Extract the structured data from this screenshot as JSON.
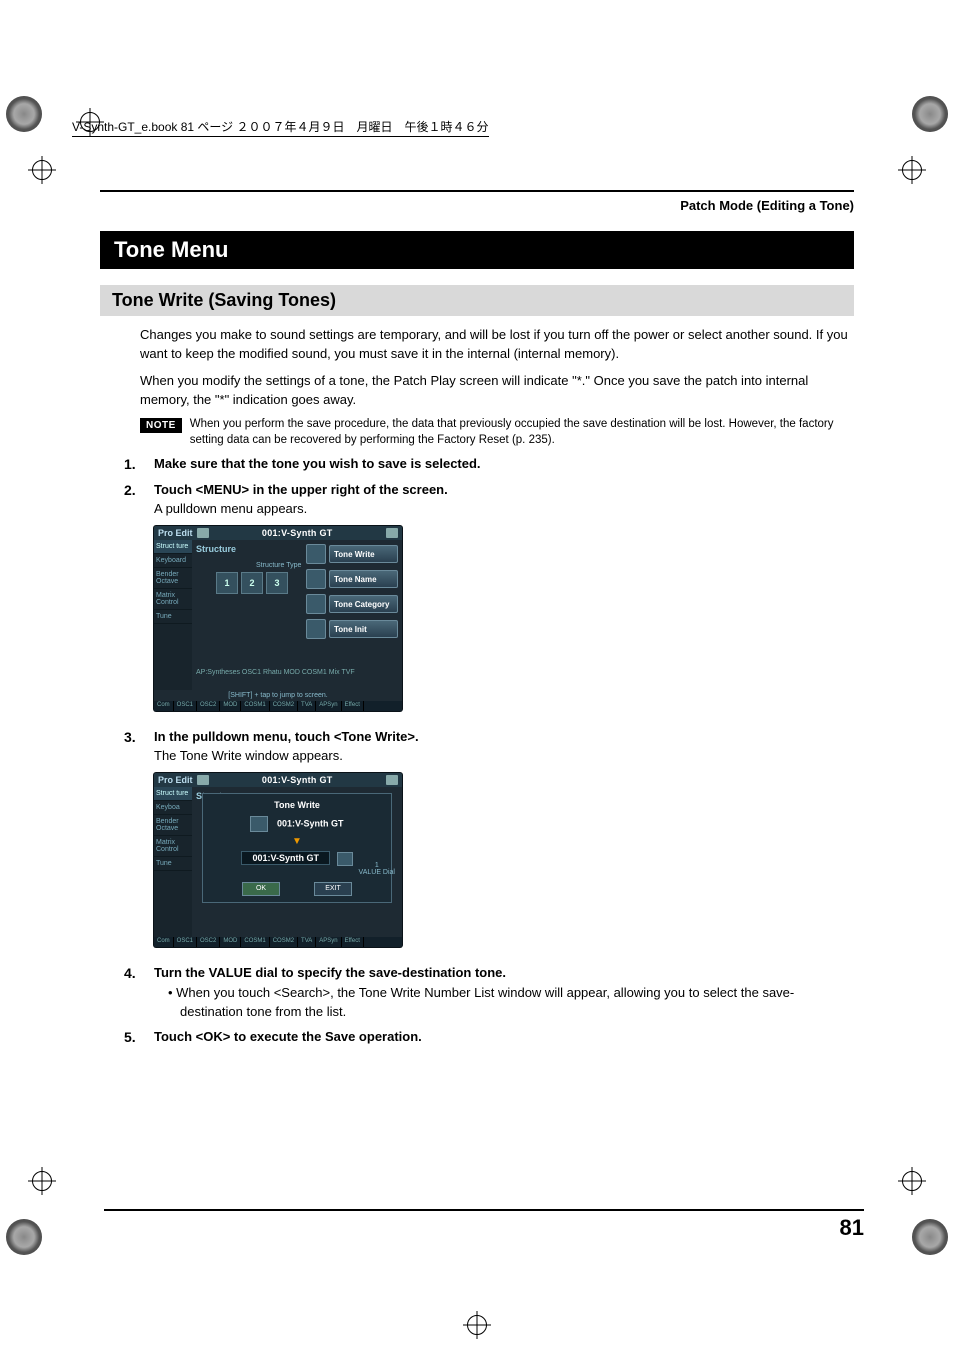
{
  "header_line": "V-Synth-GT_e.book  81 ページ  ２００７年４月９日　月曜日　午後１時４６分",
  "page_heading": "Patch Mode (Editing a Tone)",
  "section_title": "Tone Menu",
  "subsection_title": "Tone Write (Saving Tones)",
  "intro_p1": "Changes you make to sound settings are temporary, and will be lost if you turn off the power or select another sound. If you want to keep the modified sound, you must save it in the internal (internal memory).",
  "intro_p2": "When you modify the settings of a tone, the Patch Play screen will indicate \"*.\" Once you save the patch into internal memory, the \"*\" indication goes away.",
  "note_badge": "NOTE",
  "note_text": "When you perform the save procedure, the data that previously occupied the save destination will be lost. However, the factory setting data can be recovered by performing the Factory Reset (p. 235).",
  "steps": {
    "s1": {
      "num": "1.",
      "title": "Make sure that the tone you wish to save is selected."
    },
    "s2": {
      "num": "2.",
      "title": "Touch <MENU> in the upper right of the screen.",
      "desc": "A pulldown menu appears."
    },
    "s3": {
      "num": "3.",
      "title": "In the pulldown menu, touch <Tone Write>.",
      "desc": "The Tone Write window appears."
    },
    "s4": {
      "num": "4.",
      "title": "Turn the VALUE dial to specify the save-destination tone.",
      "bullet": "• When you touch <Search>, the Tone Write Number List window will appear, allowing you to select the save-destination tone from the list."
    },
    "s5": {
      "num": "5.",
      "title": "Touch <OK> to execute the Save operation."
    }
  },
  "screen1": {
    "title_left": "Pro Edit",
    "title_center": "001:V-Synth GT",
    "structure_label": "Structure",
    "sidebar": [
      "Struct ture",
      "Keyboard",
      "Bender Octave",
      "Matrix Control",
      "Tune"
    ],
    "struct_caption": "Structure Type",
    "struct_boxes": [
      "1",
      "2",
      "3"
    ],
    "menu": [
      "Tone Write",
      "Tone Name",
      "Tone Category",
      "Tone Init"
    ],
    "lower_labels": [
      "AP:Syntheses",
      "OSC1",
      "Rhatu",
      "MOD",
      "COSM1",
      "Mix",
      "TVF"
    ],
    "hint": "[SHIFT] + tap to jump to screen.",
    "footer": [
      "Com",
      "OSC1",
      "OSC2",
      "MOD",
      "COSM1",
      "COSM2",
      "TVA",
      "APSyn",
      "Effect"
    ]
  },
  "screen2": {
    "title_left": "Pro Edit",
    "title_center": "001:V-Synth GT",
    "structure_label": "Structure",
    "sidebar": [
      "Struct ture",
      "Keyboa",
      "Bender Octave",
      "Matrix Control",
      "Tune"
    ],
    "dialog_title": "Tone Write",
    "src_name": "001:V-Synth GT",
    "dest_name": "001:V-Synth GT",
    "search_icon": "search-icon",
    "side_hint_top": "1",
    "side_hint_bot": "VALUE Dial",
    "ok": "OK",
    "exit": "EXIT",
    "footer": [
      "Com",
      "OSC1",
      "OSC2",
      "MOD",
      "COSM1",
      "COSM2",
      "TVA",
      "APSyn",
      "Effect"
    ]
  },
  "page_number": "81"
}
